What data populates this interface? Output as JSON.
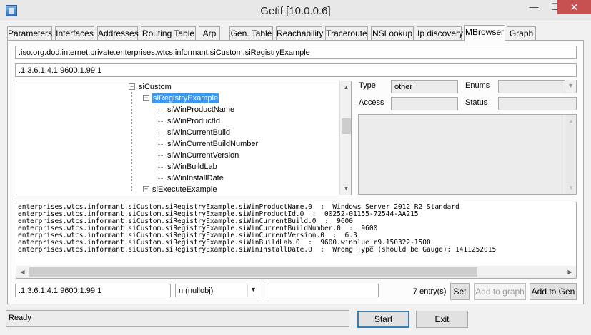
{
  "window": {
    "title": "Getif [10.0.0.6]",
    "min_glyph": "—",
    "max_glyph": "☐",
    "close_glyph": "✕"
  },
  "tabs": [
    {
      "label": "Parameters",
      "active": false
    },
    {
      "label": "Interfaces",
      "active": false
    },
    {
      "label": "Addresses",
      "active": false
    },
    {
      "label": "Routing Table",
      "active": false
    },
    {
      "label": "Arp",
      "active": false
    },
    {
      "label": "Gen. Table",
      "active": false
    },
    {
      "label": "Reachability",
      "active": false
    },
    {
      "label": "Traceroute",
      "active": false
    },
    {
      "label": "NSLookup",
      "active": false
    },
    {
      "label": "Ip discovery",
      "active": false
    },
    {
      "label": "MBrowser",
      "active": true
    },
    {
      "label": "Graph",
      "active": false
    }
  ],
  "mbrowser": {
    "oid_name": ".iso.org.dod.internet.private.enterprises.wtcs.informant.siCustom.siRegistryExample",
    "oid_number": ".1.3.6.1.4.1.9600.1.99.1",
    "tree": {
      "parent": {
        "label": "siCustom",
        "expander": "−"
      },
      "selected": {
        "label": "siRegistryExample",
        "expander": "−"
      },
      "children": [
        "siWinProductName",
        "siWinProductId",
        "siWinCurrentBuild",
        "siWinCurrentBuildNumber",
        "siWinCurrentVersion",
        "siWinBuildLab",
        "siWinInstallDate"
      ],
      "sibling": {
        "label": "siExecuteExample",
        "expander": "+"
      }
    },
    "details": {
      "type_label": "Type",
      "type_value": "other",
      "enums_label": "Enums",
      "enums_value": "",
      "access_label": "Access",
      "access_value": "",
      "status_label": "Status",
      "status_value": "",
      "description": ""
    },
    "output_lines": [
      "enterprises.wtcs.informant.siCustom.siRegistryExample.siWinProductName.0  :  Windows Server 2012 R2 Standard",
      "enterprises.wtcs.informant.siCustom.siRegistryExample.siWinProductId.0  :  00252-01155-72544-AA215",
      "enterprises.wtcs.informant.siCustom.siRegistryExample.siWinCurrentBuild.0  :  9600",
      "enterprises.wtcs.informant.siCustom.siRegistryExample.siWinCurrentBuildNumber.0  :  9600",
      "enterprises.wtcs.informant.siCustom.siRegistryExample.siWinCurrentVersion.0  :  6.3",
      "enterprises.wtcs.informant.siCustom.siRegistryExample.siWinBuildLab.0  :  9600.winblue_r9.150322-1500",
      "enterprises.wtcs.informant.siCustom.siRegistryExample.siWinInstallDate.0  :  Wrong Type (should be Gauge): 1411252015"
    ],
    "set_oid": ".1.3.6.1.4.1.9600.1.99.1",
    "set_type": "n (nullobj)",
    "set_value": "",
    "entry_count": "7 entry(s)",
    "buttons": {
      "set": "Set",
      "add_to_graph": "Add to graph",
      "add_to_gen": "Add to Gen"
    }
  },
  "status_text": "Ready",
  "buttons": {
    "start": "Start",
    "exit": "Exit"
  },
  "colors": {
    "selection": "#3399ff",
    "close_button": "#c75050",
    "default_button_border": "#3c7fb1"
  }
}
